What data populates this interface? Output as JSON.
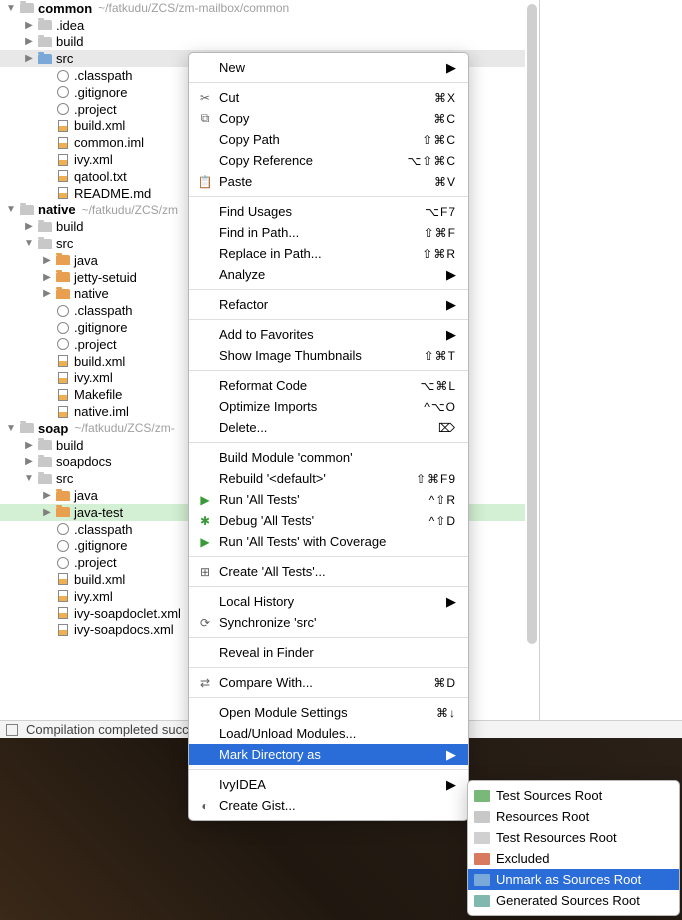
{
  "tree": {
    "nodes": [
      {
        "indent": 0,
        "arrow": "down",
        "icon": "folder",
        "bold": true,
        "label": "common",
        "path": "~/fatkudu/ZCS/zm-mailbox/common"
      },
      {
        "indent": 1,
        "arrow": "right",
        "icon": "folder",
        "label": ".idea"
      },
      {
        "indent": 1,
        "arrow": "right",
        "icon": "folder",
        "label": "build"
      },
      {
        "indent": 1,
        "arrow": "right",
        "icon": "folder-blue",
        "label": "src",
        "selected": true
      },
      {
        "indent": 2,
        "arrow": "none",
        "icon": "dot",
        "label": ".classpath"
      },
      {
        "indent": 2,
        "arrow": "none",
        "icon": "dot",
        "label": ".gitignore"
      },
      {
        "indent": 2,
        "arrow": "none",
        "icon": "dot",
        "label": ".project"
      },
      {
        "indent": 2,
        "arrow": "none",
        "icon": "xml",
        "label": "build.xml"
      },
      {
        "indent": 2,
        "arrow": "none",
        "icon": "xml",
        "label": "common.iml"
      },
      {
        "indent": 2,
        "arrow": "none",
        "icon": "xml",
        "label": "ivy.xml"
      },
      {
        "indent": 2,
        "arrow": "none",
        "icon": "xml",
        "label": "qatool.txt"
      },
      {
        "indent": 2,
        "arrow": "none",
        "icon": "xml",
        "label": "README.md"
      },
      {
        "indent": 0,
        "arrow": "down",
        "icon": "folder",
        "bold": true,
        "label": "native",
        "path": "~/fatkudu/ZCS/zm"
      },
      {
        "indent": 1,
        "arrow": "right",
        "icon": "folder",
        "label": "build"
      },
      {
        "indent": 1,
        "arrow": "down",
        "icon": "folder",
        "label": "src"
      },
      {
        "indent": 2,
        "arrow": "right",
        "icon": "folder-orange",
        "label": "java"
      },
      {
        "indent": 2,
        "arrow": "right",
        "icon": "folder-orange",
        "label": "jetty-setuid"
      },
      {
        "indent": 2,
        "arrow": "right",
        "icon": "folder-orange",
        "label": "native"
      },
      {
        "indent": 2,
        "arrow": "none",
        "icon": "dot",
        "label": ".classpath"
      },
      {
        "indent": 2,
        "arrow": "none",
        "icon": "dot",
        "label": ".gitignore"
      },
      {
        "indent": 2,
        "arrow": "none",
        "icon": "dot",
        "label": ".project"
      },
      {
        "indent": 2,
        "arrow": "none",
        "icon": "xml",
        "label": "build.xml"
      },
      {
        "indent": 2,
        "arrow": "none",
        "icon": "xml",
        "label": "ivy.xml"
      },
      {
        "indent": 2,
        "arrow": "none",
        "icon": "xml",
        "label": "Makefile"
      },
      {
        "indent": 2,
        "arrow": "none",
        "icon": "xml",
        "label": "native.iml"
      },
      {
        "indent": 0,
        "arrow": "down",
        "icon": "folder",
        "bold": true,
        "label": "soap",
        "path": "~/fatkudu/ZCS/zm-"
      },
      {
        "indent": 1,
        "arrow": "right",
        "icon": "folder",
        "label": "build"
      },
      {
        "indent": 1,
        "arrow": "right",
        "icon": "folder",
        "label": "soapdocs"
      },
      {
        "indent": 1,
        "arrow": "down",
        "icon": "folder",
        "label": "src"
      },
      {
        "indent": 2,
        "arrow": "right",
        "icon": "folder-orange",
        "label": "java"
      },
      {
        "indent": 2,
        "arrow": "right",
        "icon": "folder-orange",
        "label": "java-test",
        "highlight": true
      },
      {
        "indent": 2,
        "arrow": "none",
        "icon": "dot",
        "label": ".classpath"
      },
      {
        "indent": 2,
        "arrow": "none",
        "icon": "dot",
        "label": ".gitignore"
      },
      {
        "indent": 2,
        "arrow": "none",
        "icon": "dot",
        "label": ".project"
      },
      {
        "indent": 2,
        "arrow": "none",
        "icon": "xml",
        "label": "build.xml"
      },
      {
        "indent": 2,
        "arrow": "none",
        "icon": "xml",
        "label": "ivy.xml"
      },
      {
        "indent": 2,
        "arrow": "none",
        "icon": "xml",
        "label": "ivy-soapdoclet.xml"
      },
      {
        "indent": 2,
        "arrow": "none",
        "icon": "xml",
        "label": "ivy-soapdocs.xml"
      }
    ]
  },
  "status": {
    "text": "Compilation completed success"
  },
  "menu": {
    "groups": [
      [
        {
          "label": "New",
          "sub": true
        }
      ],
      [
        {
          "icon": "✂",
          "label": "Cut",
          "short": "⌘X"
        },
        {
          "icon": "⧉",
          "label": "Copy",
          "short": "⌘C"
        },
        {
          "label": "Copy Path",
          "short": "⇧⌘C"
        },
        {
          "label": "Copy Reference",
          "short": "⌥⇧⌘C"
        },
        {
          "icon": "📋",
          "label": "Paste",
          "short": "⌘V"
        }
      ],
      [
        {
          "label": "Find Usages",
          "short": "⌥F7"
        },
        {
          "label": "Find in Path...",
          "short": "⇧⌘F"
        },
        {
          "label": "Replace in Path...",
          "short": "⇧⌘R"
        },
        {
          "label": "Analyze",
          "sub": true
        }
      ],
      [
        {
          "label": "Refactor",
          "sub": true
        }
      ],
      [
        {
          "label": "Add to Favorites",
          "sub": true
        },
        {
          "label": "Show Image Thumbnails",
          "short": "⇧⌘T"
        }
      ],
      [
        {
          "label": "Reformat Code",
          "short": "⌥⌘L"
        },
        {
          "label": "Optimize Imports",
          "short": "^⌥O"
        },
        {
          "label": "Delete...",
          "short": "⌦"
        }
      ],
      [
        {
          "label": "Build Module 'common'"
        },
        {
          "label": "Rebuild '<default>'",
          "short": "⇧⌘F9"
        },
        {
          "icon": "▶",
          "iconColor": "#3a9a3a",
          "label": "Run 'All Tests'",
          "short": "^⇧R"
        },
        {
          "icon": "✱",
          "iconColor": "#3a9a3a",
          "label": "Debug 'All Tests'",
          "short": "^⇧D"
        },
        {
          "icon": "▶",
          "iconColor": "#3a9a3a",
          "label": "Run 'All Tests' with Coverage"
        }
      ],
      [
        {
          "icon": "⊞",
          "label": "Create 'All Tests'..."
        }
      ],
      [
        {
          "label": "Local History",
          "sub": true
        },
        {
          "icon": "⟳",
          "label": "Synchronize 'src'"
        }
      ],
      [
        {
          "label": "Reveal in Finder"
        }
      ],
      [
        {
          "icon": "⇄",
          "label": "Compare With...",
          "short": "⌘D"
        }
      ],
      [
        {
          "label": "Open Module Settings",
          "short": "⌘↓"
        },
        {
          "label": "Load/Unload Modules..."
        },
        {
          "label": "Mark Directory as",
          "sub": true,
          "selected": true
        }
      ],
      [
        {
          "label": "IvyIDEA",
          "sub": true
        },
        {
          "icon": "◐",
          "label": "Create Gist..."
        }
      ]
    ]
  },
  "submenu": {
    "items": [
      {
        "color": "fgreen",
        "label": "Test Sources Root"
      },
      {
        "color": "fgrey",
        "label": "Resources Root"
      },
      {
        "color": "fgrey2",
        "label": "Test Resources Root"
      },
      {
        "color": "fred",
        "label": "Excluded"
      },
      {
        "color": "fblue",
        "label": "Unmark as Sources Root",
        "selected": true
      },
      {
        "color": "fteal",
        "label": "Generated Sources Root"
      }
    ]
  }
}
